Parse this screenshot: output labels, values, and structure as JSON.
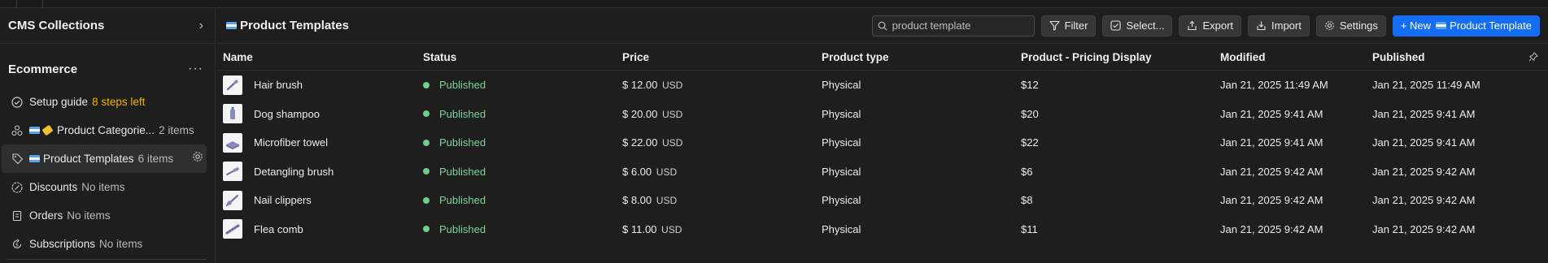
{
  "sidebar": {
    "header_title": "CMS Collections",
    "section_title": "Ecommerce",
    "items": [
      {
        "label": "Setup guide",
        "meta": "8 steps left"
      },
      {
        "label": "Product Categorie...",
        "meta": "2 items"
      },
      {
        "label": "Product Templates",
        "meta": "6 items"
      },
      {
        "label": "Discounts",
        "meta": "No items"
      },
      {
        "label": "Orders",
        "meta": "No items"
      },
      {
        "label": "Subscriptions",
        "meta": "No items"
      }
    ]
  },
  "toolbar": {
    "title": "Product Templates",
    "search_placeholder": "Search",
    "search_value": "product template",
    "filter_label": "Filter",
    "select_label": "Select...",
    "export_label": "Export",
    "import_label": "Import",
    "settings_label": "Settings",
    "new_label": "+ New",
    "new_suffix": "Product Template"
  },
  "table": {
    "columns": [
      "Name",
      "Status",
      "Price",
      "Product type",
      "Product - Pricing Display",
      "Modified",
      "Published"
    ],
    "rows": [
      {
        "name": "Hair brush",
        "status": "Published",
        "price": "$ 12.00",
        "currency": "USD",
        "type": "Physical",
        "display": "$12",
        "modified": "Jan 21, 2025 11:49 AM",
        "published": "Jan 21, 2025 11:49 AM"
      },
      {
        "name": "Dog shampoo",
        "status": "Published",
        "price": "$ 20.00",
        "currency": "USD",
        "type": "Physical",
        "display": "$20",
        "modified": "Jan 21, 2025 9:41 AM",
        "published": "Jan 21, 2025 9:41 AM"
      },
      {
        "name": "Microfiber towel",
        "status": "Published",
        "price": "$ 22.00",
        "currency": "USD",
        "type": "Physical",
        "display": "$22",
        "modified": "Jan 21, 2025 9:41 AM",
        "published": "Jan 21, 2025 9:41 AM"
      },
      {
        "name": "Detangling brush",
        "status": "Published",
        "price": "$ 6.00",
        "currency": "USD",
        "type": "Physical",
        "display": "$6",
        "modified": "Jan 21, 2025 9:42 AM",
        "published": "Jan 21, 2025 9:42 AM"
      },
      {
        "name": "Nail clippers",
        "status": "Published",
        "price": "$ 8.00",
        "currency": "USD",
        "type": "Physical",
        "display": "$8",
        "modified": "Jan 21, 2025 9:42 AM",
        "published": "Jan 21, 2025 9:42 AM"
      },
      {
        "name": "Flea comb",
        "status": "Published",
        "price": "$ 11.00",
        "currency": "USD",
        "type": "Physical",
        "display": "$11",
        "modified": "Jan 21, 2025 9:42 AM",
        "published": "Jan 21, 2025 9:42 AM"
      }
    ]
  },
  "colors": {
    "accent": "#146ef5",
    "published": "#7ed39a",
    "warning": "#f5b400"
  }
}
